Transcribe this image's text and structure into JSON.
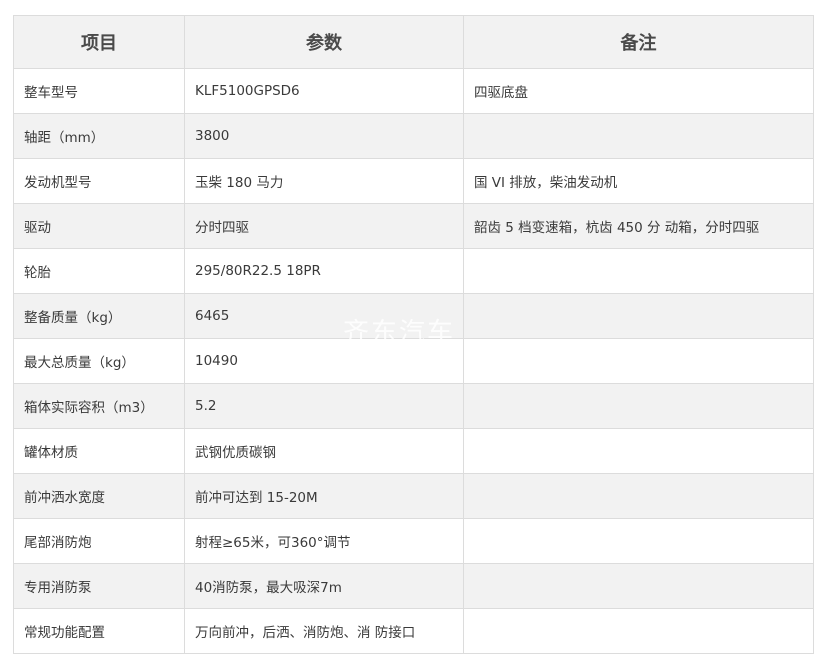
{
  "table": {
    "headers": [
      "项目",
      "参数",
      "备注"
    ],
    "rows": [
      [
        "整车型号",
        "KLF5100GPSD6",
        "四驱底盘"
      ],
      [
        "轴距（mm）",
        "3800",
        ""
      ],
      [
        "发动机型号",
        "玉柴 180 马力",
        "国 VI 排放，柴油发动机"
      ],
      [
        "驱动",
        "分时四驱",
        "韶齿 5 档变速箱，杭齿 450 分 动箱，分时四驱"
      ],
      [
        "轮胎",
        "295/80R22.5  18PR",
        ""
      ],
      [
        "整备质量（kg）",
        "6465",
        ""
      ],
      [
        "最大总质量（kg）",
        "10490",
        ""
      ],
      [
        "箱体实际容积（m3）",
        "5.2",
        ""
      ],
      [
        "罐体材质",
        "武钢优质碳钢",
        ""
      ],
      [
        "前冲洒水宽度",
        "前冲可达到 15-20M",
        ""
      ],
      [
        "尾部消防炮",
        "射程≥65米，可360°调节",
        ""
      ],
      [
        "专用消防泵",
        "40消防泵，最大吸深7m",
        ""
      ],
      [
        "常规功能配置",
        "万向前冲，后洒、消防炮、消 防接口",
        ""
      ]
    ]
  },
  "watermark": "齐东汽车"
}
